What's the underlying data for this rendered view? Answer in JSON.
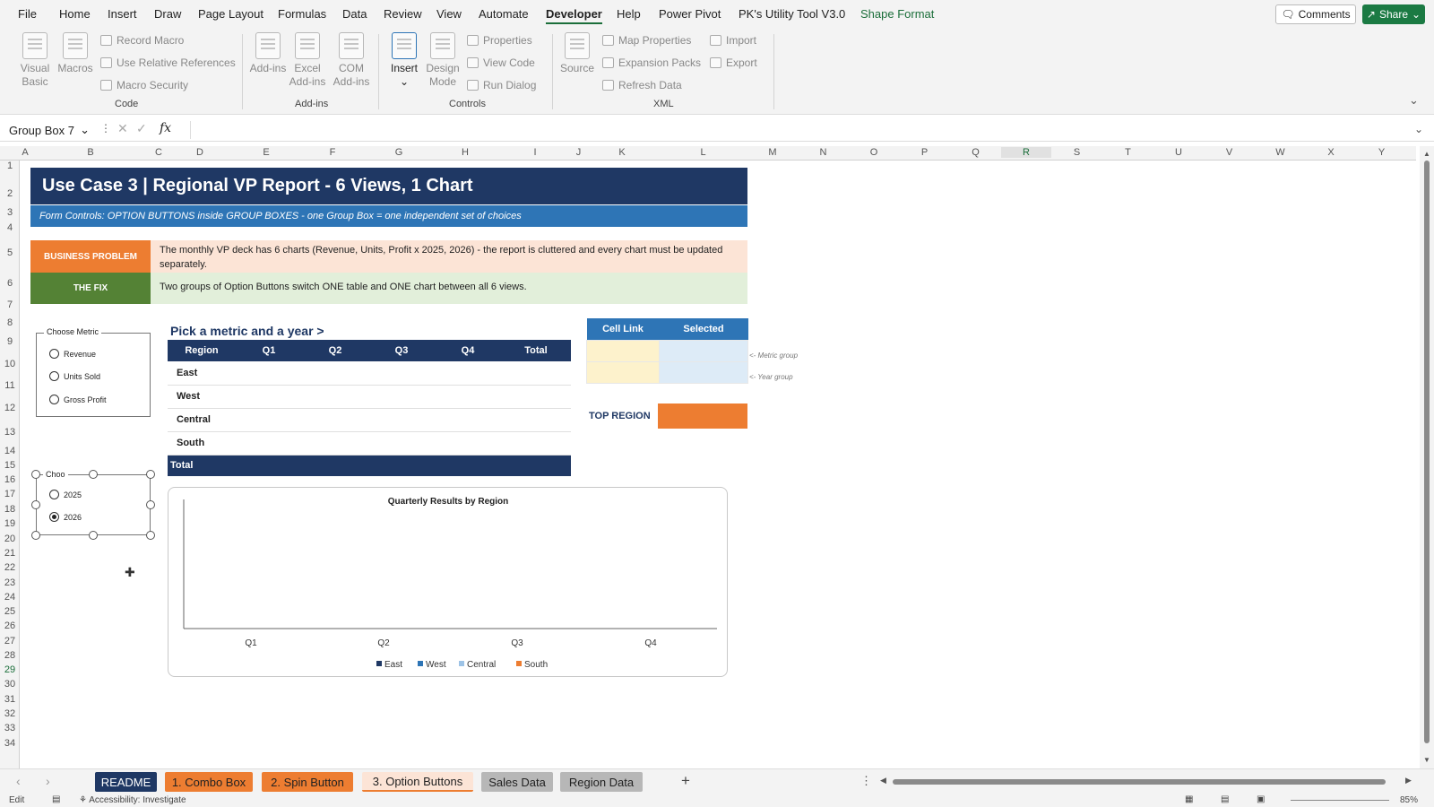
{
  "menu": {
    "tabs": [
      "File",
      "Home",
      "Insert",
      "Draw",
      "Page Layout",
      "Formulas",
      "Data",
      "Review",
      "View",
      "Automate",
      "Developer",
      "Help",
      "Power Pivot",
      "PK's Utility Tool V3.0",
      "Shape Format"
    ],
    "comments": "Comments",
    "share": "Share"
  },
  "ribbon": {
    "visual_basic": "Visual Basic",
    "macros": "Macros",
    "record_macro": "Record Macro",
    "use_relative_references": "Use Relative References",
    "macro_security": "Macro Security",
    "code_group": "Code",
    "add_ins": "Add-ins",
    "excel_add_ins": "Excel Add-ins",
    "com_add_ins": "COM Add-ins",
    "add_ins_group": "Add-ins",
    "insert": "Insert",
    "design_mode": "Design Mode",
    "properties": "Properties",
    "view_code": "View Code",
    "run_dialog": "Run Dialog",
    "controls_group": "Controls",
    "source": "Source",
    "map_properties": "Map Properties",
    "expansion_packs": "Expansion Packs",
    "refresh_data": "Refresh Data",
    "import": "Import",
    "export": "Export",
    "xml_group": "XML"
  },
  "formula_bar": {
    "name_box": "Group Box 7",
    "fx": "fx",
    "value": ""
  },
  "columns": [
    "A",
    "B",
    "C",
    "D",
    "E",
    "F",
    "G",
    "H",
    "I",
    "J",
    "K",
    "L",
    "M",
    "N",
    "O",
    "P",
    "Q",
    "R",
    "S",
    "T",
    "U",
    "V",
    "W",
    "X",
    "Y"
  ],
  "selected_column": "R",
  "rows": [
    "1",
    "2",
    "3",
    "4",
    "5",
    "6",
    "7",
    "8",
    "9",
    "10",
    "11",
    "12",
    "13",
    "14",
    "15",
    "16",
    "17",
    "18",
    "19",
    "20",
    "21",
    "22",
    "23",
    "24",
    "25",
    "26",
    "27",
    "28",
    "29",
    "30",
    "31",
    "32",
    "33",
    "34"
  ],
  "selected_row": "29",
  "sheet": {
    "title": "Use Case 3  |  Regional VP Report - 6 Views, 1 Chart",
    "subtitle": "Form Controls: OPTION BUTTONS inside GROUP BOXES   -   one Group Box = one independent set of choices",
    "problem_label": "BUSINESS PROBLEM",
    "problem_text": "The monthly VP deck has 6 charts (Revenue, Units, Profit x 2025, 2026) - the report is cluttered and every chart must be updated separately.",
    "fix_label": "THE FIX",
    "fix_text": "Two groups of Option Buttons switch ONE table and ONE chart between all 6 views.",
    "metric_group": {
      "title": "Choose Metric",
      "options": [
        {
          "label": "Revenue",
          "selected": false
        },
        {
          "label": "Units Sold",
          "selected": false
        },
        {
          "label": "Gross Profit",
          "selected": false
        }
      ]
    },
    "year_group": {
      "title": "Choo",
      "options": [
        {
          "label": "2025",
          "selected": false
        },
        {
          "label": "2026",
          "selected": true
        }
      ]
    },
    "pick_heading": "Pick a metric and a year  >",
    "table": {
      "headers": [
        "Region",
        "Q1",
        "Q2",
        "Q3",
        "Q4",
        "Total"
      ],
      "rows": [
        "East",
        "West",
        "Central",
        "South"
      ],
      "total_label": "Total"
    },
    "cell_link": {
      "headers": [
        "Cell Link",
        "Selected"
      ],
      "notes": [
        "<- Metric group",
        "<- Year group"
      ]
    },
    "top_region_label": "TOP REGION",
    "chart": {
      "title": "Quarterly Results by Region",
      "categories": [
        "Q1",
        "Q2",
        "Q3",
        "Q4"
      ],
      "legend": [
        {
          "name": "East",
          "color": "#1f3864"
        },
        {
          "name": "West",
          "color": "#2e75b6"
        },
        {
          "name": "Central",
          "color": "#9dc3e6"
        },
        {
          "name": "South",
          "color": "#ed7d31"
        }
      ]
    }
  },
  "chart_data": {
    "type": "bar",
    "title": "Quarterly Results by Region",
    "categories": [
      "Q1",
      "Q2",
      "Q3",
      "Q4"
    ],
    "series": [
      {
        "name": "East",
        "values": []
      },
      {
        "name": "West",
        "values": []
      },
      {
        "name": "Central",
        "values": []
      },
      {
        "name": "South",
        "values": []
      }
    ],
    "legend": "bottom",
    "grid": false
  },
  "sheet_tabs": [
    {
      "label": "README",
      "color": "#1f3864",
      "text_color": "#ffffff"
    },
    {
      "label": "1. Combo Box",
      "color": "#ed7d31",
      "text_color": "#222222"
    },
    {
      "label": "2. Spin Button",
      "color": "#ed7d31",
      "text_color": "#222222"
    },
    {
      "label": "3. Option Buttons",
      "color": "#fce4d6",
      "text_color": "#222222",
      "active": true
    },
    {
      "label": "Sales Data",
      "color": "#b7b7b7",
      "text_color": "#222222"
    },
    {
      "label": "Region Data",
      "color": "#b7b7b7",
      "text_color": "#222222"
    }
  ],
  "status": {
    "mode": "Edit",
    "accessibility": "Accessibility: Investigate",
    "zoom": "85%"
  }
}
